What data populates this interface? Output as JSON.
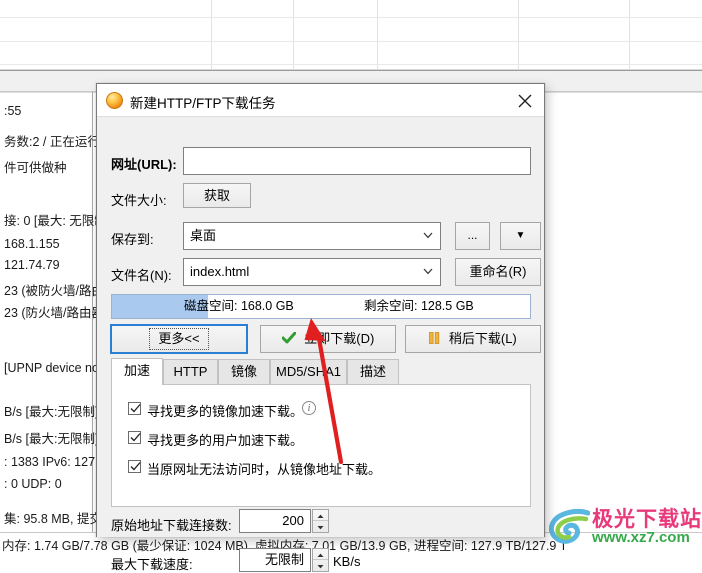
{
  "background": {
    "status_lines": [
      ":55",
      "务数:2 / 正在运行:",
      "件可供做种",
      "接: 0 [最大: 无限制",
      "168.1.155",
      "121.74.79",
      "23 (被防火墙/路由",
      "23 (防火墙/路由器",
      "[UPNP device no",
      "B/s [最大:无限制]",
      "B/s [最大:无限制]",
      ": 1383  IPv6: 127",
      ": 0  UDP: 0",
      "集: 95.8 MB, 提交",
      "内存: 1.74 GB/7.7"
    ],
    "status_bar": "内存: 1.74 GB/7.78 GB (最少保证: 1024 MB), 虚拟内存: 7.01 GB/13.9 GB, 进程空间: 127.9 TB/127.9 T"
  },
  "watermark": {
    "title": "极光下载站",
    "url": "www.xz7.com",
    "title_color": "#e8397a",
    "url_color": "#36a94a"
  },
  "dialog": {
    "title": "新建HTTP/FTP下载任务",
    "icon": "download-ball-icon",
    "close_icon": "close-icon",
    "url_label": "网址(URL):",
    "url_value": "",
    "url_placeholder": "",
    "filesize_label": "文件大小:",
    "fetch_button": "获取",
    "saveto_label": "保存到:",
    "saveto_value": "桌面",
    "browse_button": "...",
    "dropdown_button": "▼",
    "filename_label": "文件名(N):",
    "filename_value": "index.html",
    "rename_button": "重命名(R)",
    "disk": {
      "total_label": "磁盘空间: 168.0 GB",
      "free_label": "剩余空间: 128.5 GB",
      "fill_percent": 23,
      "fill_color": "#a9c9ef"
    },
    "buttons": {
      "more": "更多<<",
      "download_now": "立即下载(D)",
      "download_later": "稍后下载(L)",
      "check_icon": "check-icon",
      "pause_icon": "pause-icon"
    },
    "tabs": [
      {
        "label": "加速",
        "active": true
      },
      {
        "label": "HTTP",
        "active": false
      },
      {
        "label": "镜像",
        "active": false
      },
      {
        "label": "MD5/SHA1",
        "active": false
      },
      {
        "label": "描述",
        "active": false
      }
    ],
    "checkboxes": [
      {
        "label": "寻找更多的镜像加速下载。",
        "checked": true,
        "info": true
      },
      {
        "label": "寻找更多的用户加速下载。",
        "checked": true,
        "info": false
      },
      {
        "label": "当原网址无法访问时，从镜像地址下载。",
        "checked": true,
        "info": false
      }
    ],
    "fields": [
      {
        "label": "原始地址下载连接数:",
        "value": "200",
        "unit": ""
      },
      {
        "label": "最大下载速度:",
        "value": "无限制",
        "unit": "KB/s"
      }
    ]
  },
  "annotation": {
    "arrow_color": "#e02020",
    "arrow_name": "red-pointer-arrow"
  }
}
